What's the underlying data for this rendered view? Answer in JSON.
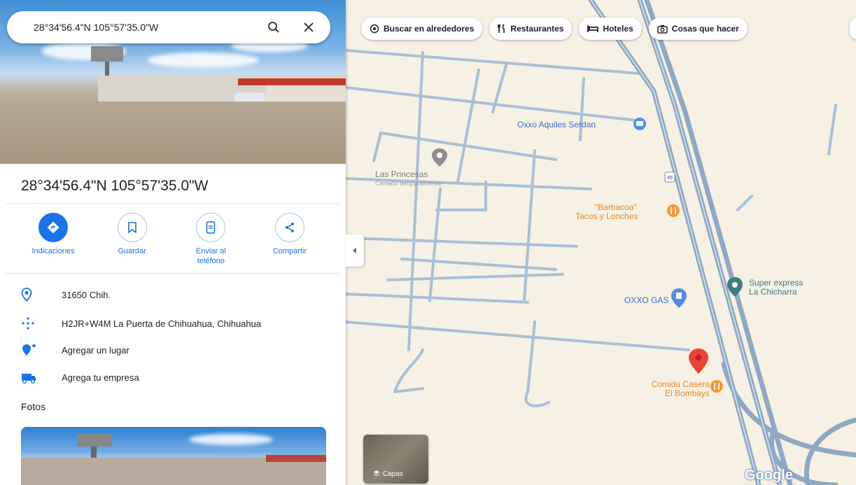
{
  "search": {
    "query": "28°34'56.4\"N 105°57'35.0\"W"
  },
  "place": {
    "title": "28°34'56.4\"N 105°57'35.0\"W"
  },
  "actions": [
    {
      "label": "Indicaciones",
      "icon": "directions-icon"
    },
    {
      "label": "Guardar",
      "icon": "bookmark-icon"
    },
    {
      "label": "Enviar al teléfono",
      "icon": "send-to-phone-icon"
    },
    {
      "label": "Compartir",
      "icon": "share-icon"
    }
  ],
  "info": {
    "postal": "31650 Chih.",
    "plus_code": "H2JR+W4M La Puerta de Chihuahua, Chihuahua",
    "add_place": "Agregar un lugar",
    "add_business": "Agrega tu empresa"
  },
  "photos_heading": "Fotos",
  "chips": [
    {
      "label": "Buscar en alrededores",
      "icon": "nearby-icon"
    },
    {
      "label": "Restaurantes",
      "icon": "restaurant-icon"
    },
    {
      "label": "Hoteles",
      "icon": "hotel-icon"
    },
    {
      "label": "Cosas que hacer",
      "icon": "camera-icon"
    }
  ],
  "map": {
    "pois": {
      "oxxo_aquiles": "Oxxo Aquiles Serdan",
      "princesas": "Las Princesas",
      "princesas_status": "Cerrado temporalmente",
      "barbacoa_1": "\"Barbacoa\"",
      "barbacoa_2": "Tacos y Lonches",
      "super_1": "Super express",
      "super_2": "La Chicharra",
      "oxxo_gas": "OXXO GAS",
      "comida_1": "Comida Casera",
      "comida_2": "El Bombays"
    },
    "highway_shield": "45",
    "layers_label": "Capas",
    "logo": "Google"
  },
  "colors": {
    "accent": "#1a73e8",
    "food_poi": "#f29a3c",
    "shop_poi": "#3f7c87",
    "pin": "#ea4335",
    "road": "#a9bfd6",
    "highway": "#8fa8c4",
    "map_bg": "#f6f1e4"
  }
}
